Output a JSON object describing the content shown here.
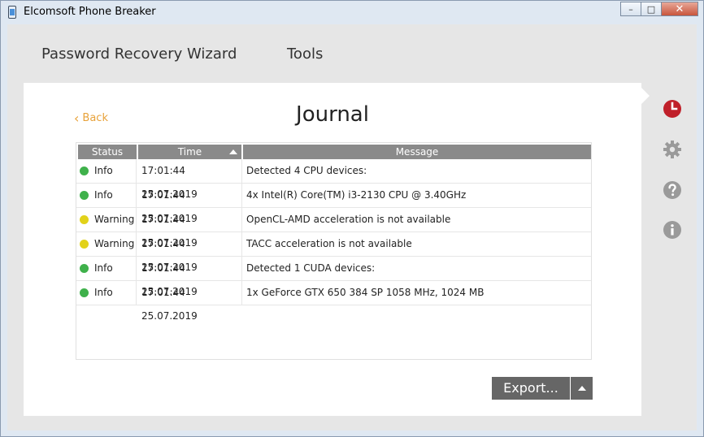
{
  "window": {
    "title": "Elcomsoft Phone Breaker"
  },
  "menu": {
    "wizard": "Password Recovery Wizard",
    "tools": "Tools"
  },
  "page": {
    "back": "Back",
    "title": "Journal"
  },
  "grid": {
    "headers": {
      "status": "Status",
      "time": "Time",
      "message": "Message"
    },
    "rows": [
      {
        "status": "Info",
        "time": "17:01:44 25.07.2019",
        "message": "Detected 4 CPU devices:"
      },
      {
        "status": "Info",
        "time": "17:01:44 25.07.2019",
        "message": "4x Intel(R) Core(TM) i3-2130 CPU @ 3.40GHz"
      },
      {
        "status": "Warning",
        "time": "17:01:44 25.07.2019",
        "message": "OpenCL-AMD acceleration is not available"
      },
      {
        "status": "Warning",
        "time": "17:01:44 25.07.2019",
        "message": "TACC acceleration is not available"
      },
      {
        "status": "Info",
        "time": "17:01:44 25.07.2019",
        "message": "Detected 1 CUDA devices:"
      },
      {
        "status": "Info",
        "time": "17:01:44 25.07.2019",
        "message": "1x GeForce GTX 650 384 SP 1058 MHz, 1024 MB"
      }
    ]
  },
  "export": {
    "label": "Export..."
  },
  "colors": {
    "info": "#3fb14b",
    "warning": "#e2d21a",
    "accent": "#e8a23a",
    "journal_active": "#c0202a",
    "icon_inactive": "#9a9a9a"
  },
  "sidebar_icons": [
    "journal-clock-icon",
    "settings-gear-icon",
    "help-icon",
    "info-icon"
  ]
}
